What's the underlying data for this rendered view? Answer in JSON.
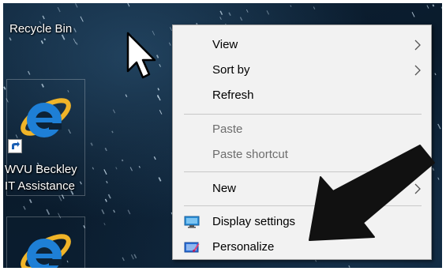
{
  "desktop": {
    "icons": [
      {
        "label": "Recycle Bin"
      },
      {
        "label_lines": [
          "WVU Beckley",
          "IT Assistance"
        ]
      },
      {
        "label": ""
      }
    ]
  },
  "context_menu": {
    "items": [
      {
        "label": "View",
        "submenu": true,
        "disabled": false
      },
      {
        "label": "Sort by",
        "submenu": true,
        "disabled": false
      },
      {
        "label": "Refresh",
        "submenu": false,
        "disabled": false
      },
      {
        "label": "Paste",
        "submenu": false,
        "disabled": true
      },
      {
        "label": "Paste shortcut",
        "submenu": false,
        "disabled": true
      },
      {
        "label": "New",
        "submenu": true,
        "disabled": false
      },
      {
        "label": "Display settings",
        "icon": "display-icon",
        "disabled": false
      },
      {
        "label": "Personalize",
        "icon": "personalize-icon",
        "disabled": false
      }
    ]
  },
  "colors": {
    "menu_bg": "#f2f2f2",
    "disabled_text": "#6d6d6d",
    "ie_blue": "#1e7fd6",
    "ie_ring": "#f0b428"
  }
}
